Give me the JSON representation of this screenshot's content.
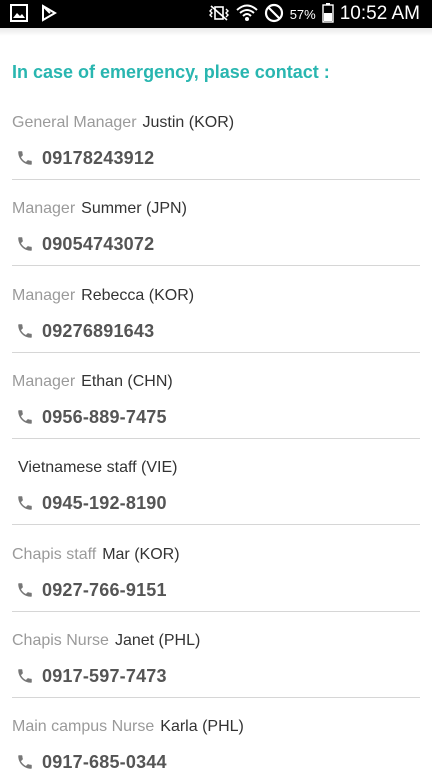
{
  "status_bar": {
    "battery": "57%",
    "time": "10:52 AM"
  },
  "title": "In case of emergency, plase contact :",
  "contacts": [
    {
      "role": "General Manager",
      "name": "Justin (KOR)",
      "phone": "09178243912"
    },
    {
      "role": "Manager",
      "name": "Summer (JPN)",
      "phone": "09054743072"
    },
    {
      "role": "Manager",
      "name": "Rebecca (KOR)",
      "phone": "09276891643"
    },
    {
      "role": "Manager",
      "name": "Ethan (CHN)",
      "phone": "0956-889-7475"
    },
    {
      "role": "",
      "name": "Vietnamese staff (VIE)",
      "phone": "0945-192-8190"
    },
    {
      "role": "Chapis staff",
      "name": "Mar (KOR)",
      "phone": "0927-766-9151"
    },
    {
      "role": "Chapis Nurse",
      "name": "Janet (PHL)",
      "phone": "0917-597-7473"
    },
    {
      "role": "Main campus Nurse",
      "name": "Karla (PHL)",
      "phone": "0917-685-0344"
    }
  ],
  "icons": {
    "phone": "phone-icon",
    "gallery": "image-notification-icon",
    "flag": "play-store-notification-icon",
    "mute": "vibrate-mute-icon",
    "wifi": "wifi-icon",
    "block": "do-not-disturb-icon",
    "battery": "battery-icon"
  }
}
